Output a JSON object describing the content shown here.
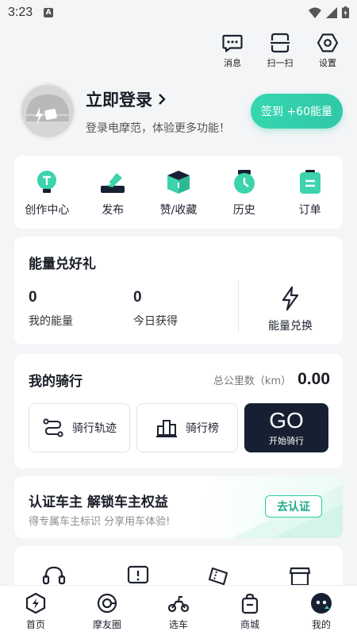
{
  "status_bar": {
    "time": "3:23",
    "badge": "A"
  },
  "top_actions": [
    {
      "label": "消息",
      "icon": "message-icon"
    },
    {
      "label": "扫一扫",
      "icon": "scan-icon"
    },
    {
      "label": "设置",
      "icon": "settings-icon"
    }
  ],
  "profile": {
    "title": "立即登录",
    "subtitle": "登录电摩范，体验更多功能！",
    "checkin_label": "签到 +60能量"
  },
  "quick_menu": [
    {
      "label": "创作中心",
      "icon": "create-center-icon"
    },
    {
      "label": "发布",
      "icon": "publish-icon"
    },
    {
      "label": "赞/收藏",
      "icon": "like-favorite-icon"
    },
    {
      "label": "历史",
      "icon": "history-icon"
    },
    {
      "label": "订单",
      "icon": "order-icon"
    }
  ],
  "energy": {
    "title": "能量兑好礼",
    "my_energy_value": "0",
    "my_energy_label": "我的能量",
    "today_value": "0",
    "today_label": "今日获得",
    "exchange_label": "能量兑换"
  },
  "ride": {
    "title": "我的骑行",
    "total_label": "总公里数（km）",
    "total_value": "0.00",
    "track_label": "骑行轨迹",
    "rank_label": "骑行榜",
    "go_label": "GO",
    "go_sub": "开始骑行"
  },
  "cert": {
    "title": "认证车主 解锁车主权益",
    "subtitle": "得专属车主标识 分享用车体验!",
    "button": "去认证"
  },
  "bottom_nav": [
    {
      "label": "首页",
      "icon": "home-icon"
    },
    {
      "label": "摩友圈",
      "icon": "moto-circle-icon"
    },
    {
      "label": "选车",
      "icon": "choose-car-icon"
    },
    {
      "label": "商城",
      "icon": "mall-icon"
    },
    {
      "label": "我的",
      "icon": "mine-icon",
      "active": true
    }
  ],
  "colors": {
    "accent": "#2fc8a8",
    "dark": "#172033"
  }
}
